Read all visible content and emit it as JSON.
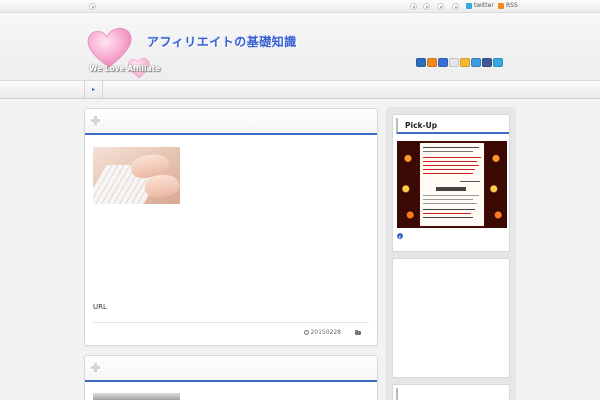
{
  "topbar": {
    "twitter_label": "twitter",
    "rss_label": "RSS"
  },
  "header": {
    "site_title": "アフィリエイトの基礎知識",
    "tagline": "We Love Affiliate"
  },
  "social_icons": [
    {
      "name": "hatena-icon",
      "color": "#2c6ebd"
    },
    {
      "name": "rss-icon",
      "color": "#f0891e"
    },
    {
      "name": "delicious-icon",
      "color": "#3a6ed0"
    },
    {
      "name": "google-icon",
      "color": "#e5e5e5"
    },
    {
      "name": "livedoor-icon",
      "color": "#f6b830"
    },
    {
      "name": "yahoo-icon",
      "color": "#3d9be0"
    },
    {
      "name": "facebook-icon",
      "color": "#3b5998"
    },
    {
      "name": "twitter-icon",
      "color": "#35a8e0"
    }
  ],
  "posts": [
    {
      "excerpt": "URL",
      "date": "20150228"
    }
  ],
  "sidebar": {
    "pickup_title": "Pick-Up"
  },
  "colors": {
    "accent": "#3e6bc4",
    "background": "#f2f2f2"
  }
}
